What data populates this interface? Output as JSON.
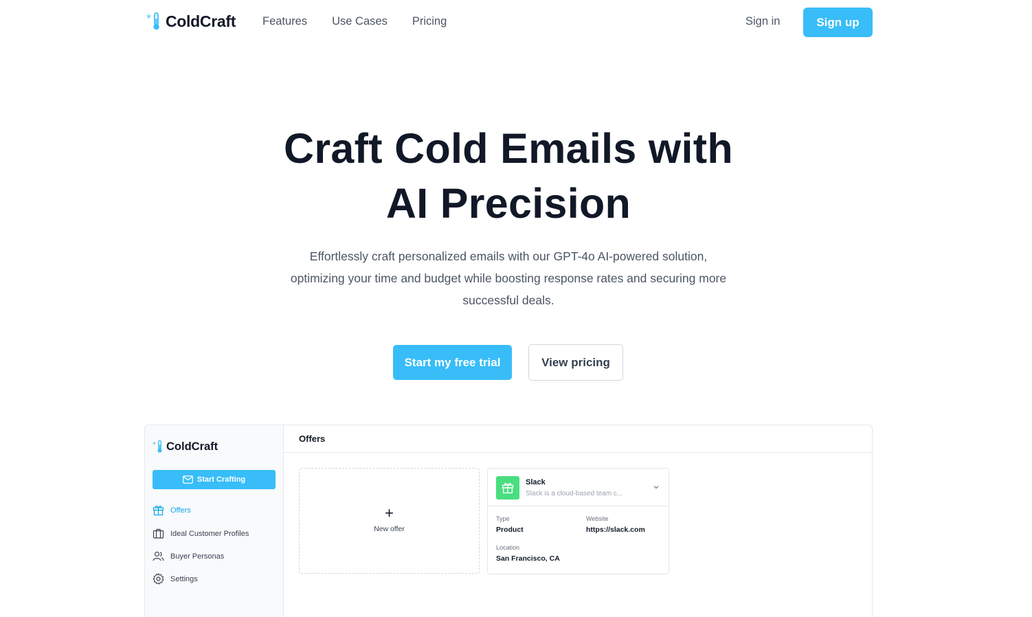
{
  "nav": {
    "brand": "ColdCraft",
    "links": [
      "Features",
      "Use Cases",
      "Pricing"
    ],
    "sign_in": "Sign in",
    "sign_up": "Sign up"
  },
  "hero": {
    "title_line1": "Craft Cold Emails with",
    "title_line2": "AI Precision",
    "subtitle": "Effortlessly craft personalized emails with our GPT-4o AI-powered solution, optimizing your time and budget while boosting response rates and securing more successful deals.",
    "primary_cta": "Start my free trial",
    "secondary_cta": "View pricing"
  },
  "app_preview": {
    "brand": "ColdCraft",
    "start_button": "Start Crafting",
    "sidebar_items": [
      {
        "label": "Offers",
        "icon": "gift-icon",
        "active": true
      },
      {
        "label": "Ideal Customer Profiles",
        "icon": "briefcase-icon",
        "active": false
      },
      {
        "label": "Buyer Personas",
        "icon": "users-icon",
        "active": false
      },
      {
        "label": "Settings",
        "icon": "gear-icon",
        "active": false
      }
    ],
    "main_title": "Offers",
    "new_offer_label": "New offer",
    "offer": {
      "name": "Slack",
      "description": "Slack is a cloud-based team c...",
      "type_label": "Type",
      "type_value": "Product",
      "website_label": "Website",
      "website_value": "https://slack.com",
      "location_label": "Location",
      "location_value": "San Francisco, CA"
    }
  },
  "colors": {
    "accent": "#38bdf8",
    "accent_text": "#0ea5e9",
    "offer_icon_bg": "#4ade80",
    "heading": "#111827",
    "body_text": "#4b5563"
  }
}
